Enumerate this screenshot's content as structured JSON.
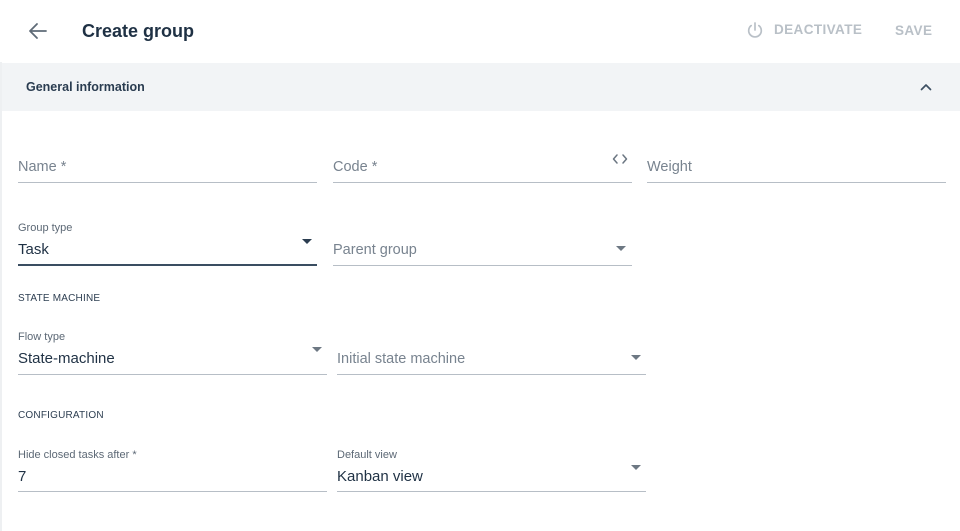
{
  "header": {
    "title": "Create group",
    "deactivate_label": "DEACTIVATE",
    "save_label": "SAVE"
  },
  "section": {
    "title": "General information"
  },
  "fields": {
    "name": {
      "placeholder": "Name *"
    },
    "code": {
      "placeholder": "Code *"
    },
    "weight": {
      "placeholder": "Weight"
    },
    "group_type": {
      "label": "Group type",
      "value": "Task"
    },
    "parent_group": {
      "placeholder": "Parent group"
    },
    "flow_type": {
      "label": "Flow type",
      "value": "State-machine"
    },
    "initial_state_machine": {
      "placeholder": "Initial state machine"
    },
    "hide_closed_tasks": {
      "label": "Hide closed tasks after *",
      "value": "7"
    },
    "default_view": {
      "label": "Default view",
      "value": "Kanban view"
    }
  },
  "subsections": {
    "state_machine": "STATE MACHINE",
    "configuration": "CONFIGURATION"
  },
  "icons": {
    "back": "arrow-left-icon",
    "power": "power-icon",
    "collapse": "chevron-up-icon",
    "code": "code-brackets-icon"
  },
  "colors": {
    "text_primary": "#1f3144",
    "disabled_action": "#b9c0c7",
    "section_bg": "#f2f4f6",
    "underline": "#b7bec6"
  }
}
